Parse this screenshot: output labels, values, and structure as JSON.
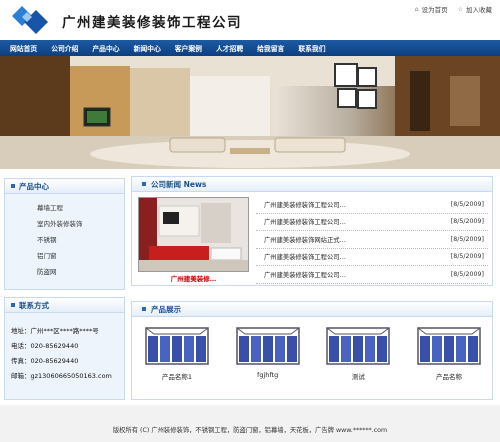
{
  "header": {
    "company_name": "广州建美装修装饰工程公司",
    "set_home": "设为首页",
    "add_favorite": "加入收藏"
  },
  "nav": [
    "网站首页",
    "公司介绍",
    "产品中心",
    "新闻中心",
    "客户案例",
    "人才招聘",
    "给我留言",
    "联系我们"
  ],
  "products_sidebar": {
    "title": "产品中心",
    "items": [
      "幕墙工程",
      "室内外装修装饰",
      "不锈钢",
      "铝门窗",
      "防盗网"
    ]
  },
  "contact": {
    "title": "联系方式",
    "address": "地址：广州***区****路****号",
    "phone": "电话：020-85629440",
    "fax": "传真：020-85629440",
    "email": "邮箱：gz13060665050163.com"
  },
  "news": {
    "title": "公司新闻 News",
    "photo_caption": "广州建美装修…",
    "items": [
      {
        "title": "广州建美装修装饰工程公司…",
        "date": "[8/5/2009]"
      },
      {
        "title": "广州建美装修装饰工程公司…",
        "date": "[8/5/2009]"
      },
      {
        "title": "广州建美装修装饰网站正式…",
        "date": "[8/5/2009]"
      },
      {
        "title": "广州建美装修装饰工程公司…",
        "date": "[8/5/2009]"
      },
      {
        "title": "广州建美装修装饰工程公司…",
        "date": "[8/5/2009]"
      }
    ]
  },
  "showcase": {
    "title": "产品展示",
    "items": [
      "产品名称1",
      "fgjhftg",
      "测试",
      "产品名称"
    ]
  },
  "footer": {
    "text": "版权所有 (C) 广州装修装饰，不锈钢工程，防盗门窗，铝幕墙，天花板，广告牌 www.******.com"
  }
}
